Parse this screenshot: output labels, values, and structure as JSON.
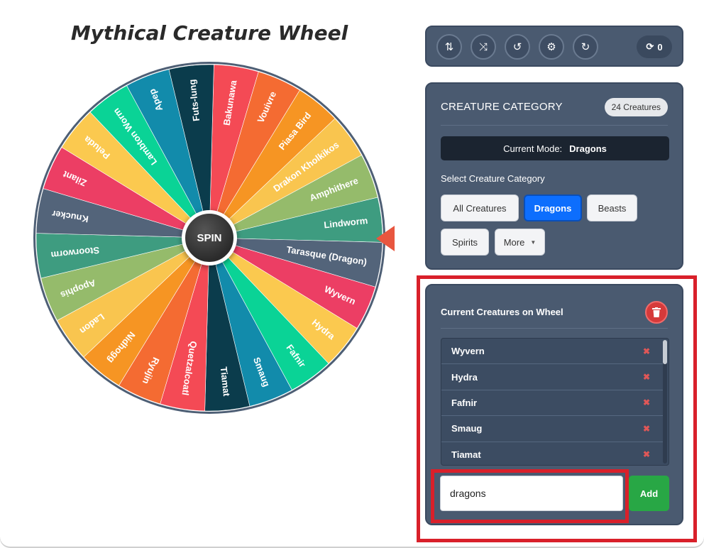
{
  "app": {
    "title": "Mythical Creature Wheel"
  },
  "wheel": {
    "spin_label": "SPIN",
    "segments": [
      {
        "label": "Bakunawa",
        "color": "#f44a55"
      },
      {
        "label": "Vouivre",
        "color": "#f46b32"
      },
      {
        "label": "Piasa Bird",
        "color": "#f69523"
      },
      {
        "label": "Drakon Kholkikos",
        "color": "#f9c54f"
      },
      {
        "label": "Amphithere",
        "color": "#95bb6b"
      },
      {
        "label": "Lindworm",
        "color": "#3e9c80"
      },
      {
        "label": "Tarasque (Dragon)",
        "color": "#53647a"
      },
      {
        "label": "Wyvern",
        "color": "#ec3e64"
      },
      {
        "label": "Hydra",
        "color": "#fbc94f"
      },
      {
        "label": "Fafnir",
        "color": "#0ad396"
      },
      {
        "label": "Smaug",
        "color": "#128bab"
      },
      {
        "label": "Tiamat",
        "color": "#0b3c4c"
      },
      {
        "label": "Quetzalcoatl",
        "color": "#f44a55"
      },
      {
        "label": "Ryujin",
        "color": "#f46b32"
      },
      {
        "label": "Nidhogg",
        "color": "#f69523"
      },
      {
        "label": "Ladon",
        "color": "#f9c54f"
      },
      {
        "label": "Apophis",
        "color": "#95bb6b"
      },
      {
        "label": "Stoorworm",
        "color": "#3e9c80"
      },
      {
        "label": "Knucker",
        "color": "#53647a"
      },
      {
        "label": "Zilant",
        "color": "#ec3e64"
      },
      {
        "label": "Peluda",
        "color": "#fbc94f"
      },
      {
        "label": "Lambton Worm",
        "color": "#0ad396"
      },
      {
        "label": "Apep",
        "color": "#128bab"
      },
      {
        "label": "Futs-lung",
        "color": "#0b3c4c"
      }
    ]
  },
  "toolbar": {
    "icons": [
      "sort-icon",
      "shuffle-icon",
      "history-icon",
      "gear-icon",
      "redo-icon"
    ],
    "counter_value": "0"
  },
  "category": {
    "header": "CREATURE CATEGORY",
    "count_badge": "24 Creatures",
    "mode_label": "Current Mode:",
    "mode_value": "Dragons",
    "select_label": "Select Creature Category",
    "chips": {
      "all": "All Creatures",
      "dragons": "Dragons",
      "beasts": "Beasts",
      "spirits": "Spirits",
      "more": "More"
    },
    "active_chip": "Dragons",
    "accent_color": "#0d6efd"
  },
  "current": {
    "title": "Current Creatures on Wheel",
    "items": [
      "Wyvern",
      "Hydra",
      "Fafnir",
      "Smaug",
      "Tiamat"
    ],
    "input_value": "dragons",
    "add_label": "Add"
  }
}
